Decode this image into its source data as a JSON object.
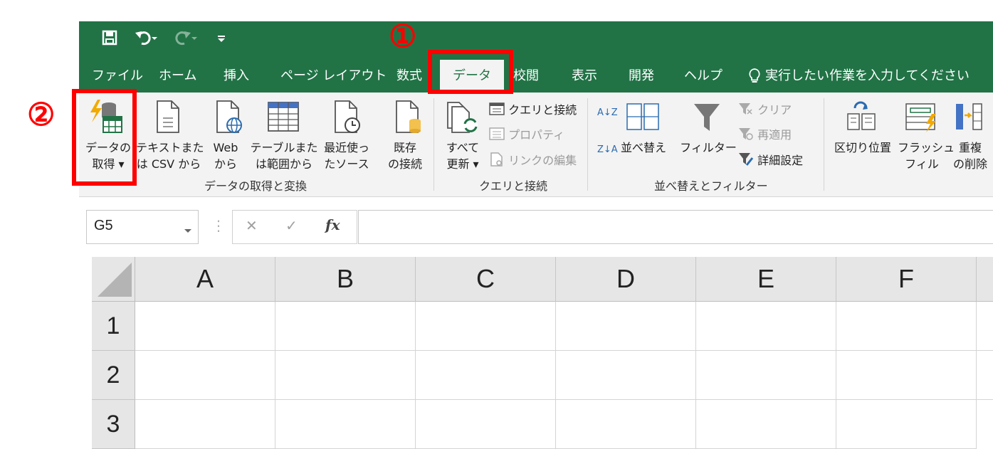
{
  "qat": {
    "save_icon": "save-icon",
    "undo_icon": "undo-icon",
    "redo_icon": "redo-icon",
    "customize_icon": "customize-qat-icon"
  },
  "tabs": [
    {
      "label": "ファイル"
    },
    {
      "label": "ホーム"
    },
    {
      "label": "挿入"
    },
    {
      "label": "ページ レイアウト"
    },
    {
      "label": "数式"
    },
    {
      "label": "データ",
      "active": true
    },
    {
      "label": "校閲"
    },
    {
      "label": "表示"
    },
    {
      "label": "開発"
    },
    {
      "label": "ヘルプ"
    }
  ],
  "tell_me": {
    "icon": "lightbulb-icon",
    "placeholder": "実行したい作業を入力してください"
  },
  "ribbon": {
    "get_data": {
      "line1": "データの",
      "line2": "取得 ▾"
    },
    "from_text": {
      "line1": "テキストまた",
      "line2": "は CSV から"
    },
    "from_web": {
      "line1": "Web",
      "line2": "から"
    },
    "from_table": {
      "line1": "テーブルまた",
      "line2": "は範囲から"
    },
    "recent_sources": {
      "line1": "最近使っ",
      "line2": "たソース"
    },
    "existing_conn": {
      "line1": "既存",
      "line2": "の接続"
    },
    "group1_label": "データの取得と変換",
    "refresh_all": {
      "line1": "すべて",
      "line2": "更新 ▾"
    },
    "queries_conn": "クエリと接続",
    "properties": "プロパティ",
    "edit_links": "リンクの編集",
    "group2_label": "クエリと接続",
    "sort_az": "A↓Z",
    "sort_za": "Z↓A",
    "sort": "並べ替え",
    "filter": "フィルター",
    "clear": "クリア",
    "reapply": "再適用",
    "advanced": "詳細設定",
    "group3_label": "並べ替えとフィルター",
    "text_to_columns": "区切り位置",
    "flash_fill": {
      "line1": "フラッシュ",
      "line2": "フィル"
    },
    "remove_dup": {
      "line1": "重複",
      "line2": "の削除"
    }
  },
  "formula_bar": {
    "name_box": "G5",
    "cancel": "✕",
    "enter": "✓",
    "fx": "fx",
    "value": ""
  },
  "columns": [
    "A",
    "B",
    "C",
    "D",
    "E",
    "F"
  ],
  "rows": [
    "1",
    "2",
    "3"
  ],
  "annotations": {
    "step1": "①",
    "step2": "②"
  },
  "colors": {
    "excel_green": "#217346",
    "highlight_red": "#ff0000"
  }
}
